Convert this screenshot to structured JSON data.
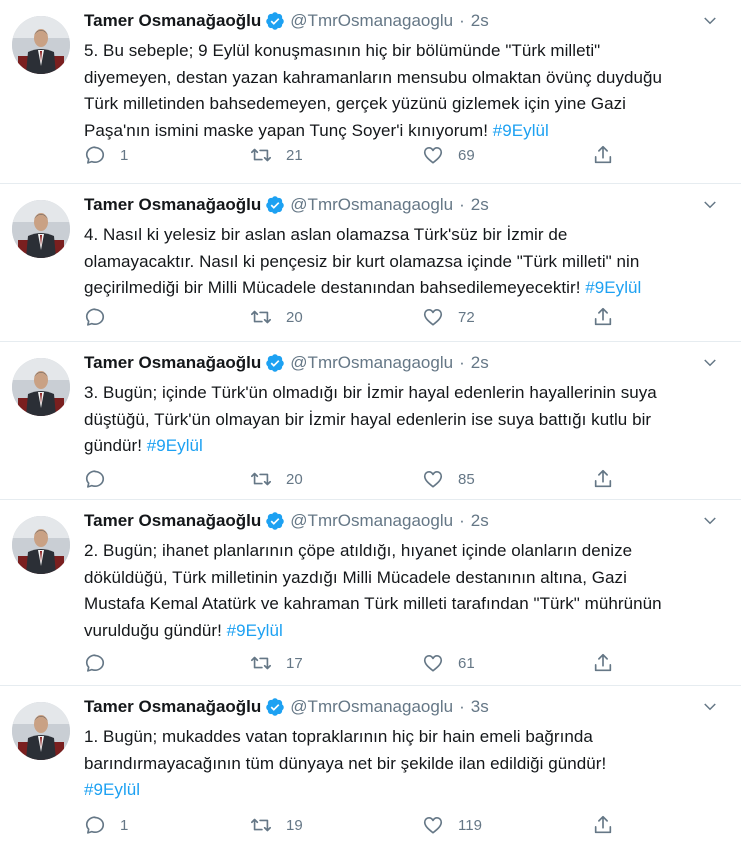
{
  "colors": {
    "accent": "#1da1f2",
    "text": "#14171a",
    "muted": "#657786",
    "divider": "#e6ecf0"
  },
  "tweets": [
    {
      "author": "Tamer Osmanağaoğlu",
      "handle": "@TmrOsmanagaoglu",
      "separator": "·",
      "time": "2s",
      "text_lines": [
        "5. Bu sebeple; 9 Eylül konuşmasının hiç bir bölümünde \"Türk milleti\"",
        "diyemeyen, destan yazan kahramanların mensubu olmaktan övünç duyduğu",
        "Türk milletinden bahsedemeyen, gerçek yüzünü gizlemek için yine Gazi",
        "Paşa'nın ismini maske yapan Tunç Soyer'i kınıyorum! "
      ],
      "hashtag": "#9Eylül",
      "replies": "1",
      "retweets": "21",
      "likes": "69",
      "icons": [
        "reply-icon",
        "retweet-icon",
        "like-icon",
        "share-icon"
      ]
    },
    {
      "author": "Tamer Osmanağaoğlu",
      "handle": "@TmrOsmanagaoglu",
      "separator": "·",
      "time": "2s",
      "text_lines": [
        "4. Nasıl ki yelesiz bir aslan aslan olamazsa Türk'süz bir İzmir de",
        "olamayacaktır. Nasıl ki pençesiz bir kurt olamazsa içinde \"Türk milleti\" nin",
        "geçirilmediği bir Milli Mücadele destanından bahsedilemeyecektir! "
      ],
      "hashtag": "#9Eylül",
      "replies": "",
      "retweets": "20",
      "likes": "72",
      "icons": [
        "reply-icon",
        "retweet-icon",
        "like-icon",
        "share-icon"
      ]
    },
    {
      "author": "Tamer Osmanağaoğlu",
      "handle": "@TmrOsmanagaoglu",
      "separator": "·",
      "time": "2s",
      "text_lines": [
        "3. Bugün; içinde Türk'ün olmadığı bir İzmir hayal edenlerin hayallerinin suya",
        "düştüğü, Türk'ün olmayan bir İzmir hayal edenlerin ise suya battığı kutlu bir",
        "gündür! "
      ],
      "hashtag": "#9Eylül",
      "replies": "",
      "retweets": "20",
      "likes": "85",
      "icons": [
        "reply-icon",
        "retweet-icon",
        "like-icon",
        "share-icon"
      ]
    },
    {
      "author": "Tamer Osmanağaoğlu",
      "handle": "@TmrOsmanagaoglu",
      "separator": "·",
      "time": "2s",
      "text_lines": [
        "2. Bugün; ihanet planlarının çöpe atıldığı, hıyanet içinde olanların denize",
        "döküldüğü, Türk milletinin yazdığı Milli Mücadele destanının altına, Gazi",
        "Mustafa Kemal Atatürk ve kahraman Türk milleti tarafından \"Türk\" mührünün",
        "vurulduğu gündür! "
      ],
      "hashtag": "#9Eylül",
      "replies": "",
      "retweets": "17",
      "likes": "61",
      "icons": [
        "reply-icon",
        "retweet-icon",
        "like-icon",
        "share-icon"
      ]
    },
    {
      "author": "Tamer Osmanağaoğlu",
      "handle": "@TmrOsmanagaoglu",
      "separator": "·",
      "time": "3s",
      "text_lines": [
        "1. Bugün; mukaddes vatan topraklarının hiç bir hain emeli bağrında",
        "barındırmayacağının tüm dünyaya net bir şekilde ilan edildiği gündür!",
        ""
      ],
      "hashtag": "#9Eylül",
      "replies": "1",
      "retweets": "19",
      "likes": "119",
      "icons": [
        "reply-icon",
        "retweet-icon",
        "like-icon",
        "share-icon"
      ]
    }
  ]
}
